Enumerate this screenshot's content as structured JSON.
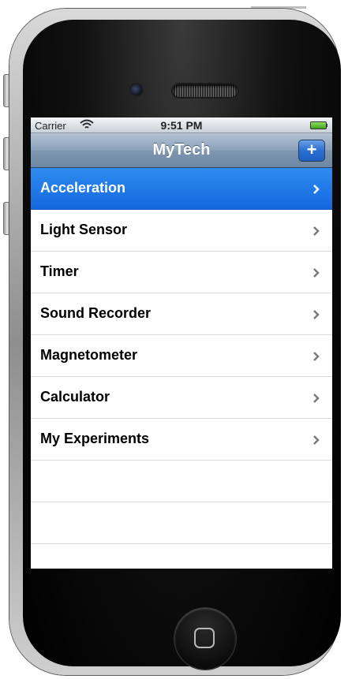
{
  "status_bar": {
    "carrier": "Carrier",
    "time": "9:51 PM",
    "wifi_icon": "wifi-icon",
    "battery_icon": "battery-icon"
  },
  "nav_bar": {
    "title": "MyTech",
    "add_button": {
      "label": "+",
      "icon": "plus-icon"
    }
  },
  "menu": {
    "items": [
      {
        "label": "Acceleration",
        "selected": true
      },
      {
        "label": "Light Sensor",
        "selected": false
      },
      {
        "label": "Timer",
        "selected": false
      },
      {
        "label": "Sound Recorder",
        "selected": false
      },
      {
        "label": "Magnetometer",
        "selected": false
      },
      {
        "label": "Calculator",
        "selected": false
      },
      {
        "label": "My Experiments",
        "selected": false
      }
    ],
    "chevron_icon": "chevron-right-icon"
  },
  "colors": {
    "selected_row": "#1f74e4",
    "nav_bar": "#7f96b0",
    "add_button": "#2c6fd1"
  }
}
